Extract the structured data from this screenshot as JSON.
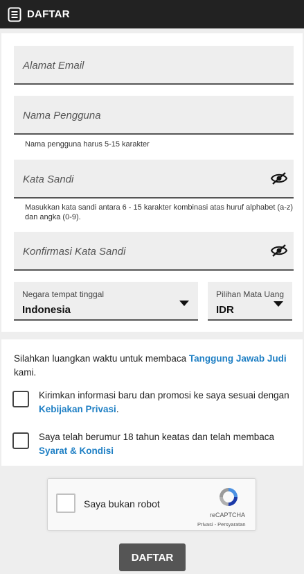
{
  "header": {
    "title": "DAFTAR",
    "icon": "document-list-icon"
  },
  "form": {
    "email": {
      "placeholder": "Alamat Email"
    },
    "username": {
      "placeholder": "Nama Pengguna",
      "hint": "Nama pengguna harus 5-15 karakter"
    },
    "password": {
      "placeholder": "Kata Sandi",
      "hint": "Masukkan kata sandi antara 6 - 15 karakter kombinasi atas huruf alphabet (a-z) dan angka (0-9)."
    },
    "confirm_password": {
      "placeholder": "Konfirmasi Kata Sandi"
    },
    "country": {
      "label": "Negara tempat tinggal",
      "value": "Indonesia"
    },
    "currency": {
      "label": "Pilihan Mata Uang",
      "value": "IDR"
    }
  },
  "terms": {
    "intro_prefix": "Silahkan luangkan waktu untuk membaca ",
    "intro_link": "Tanggung Jawab Judi",
    "intro_suffix": " kami.",
    "promo_text": "Kirimkan informasi baru dan promosi ke saya sesuai dengan ",
    "promo_link": "Kebijakan Privasi",
    "promo_suffix": ".",
    "age_text": "Saya telah berumur 18 tahun keatas dan telah membaca ",
    "age_link": "Syarat & Kondisi"
  },
  "recaptcha": {
    "label": "Saya bukan robot",
    "brand": "reCAPTCHA",
    "terms": "Privasi - Persyaratan"
  },
  "submit": {
    "label": "DAFTAR"
  },
  "colors": {
    "header_bg": "#222222",
    "link": "#1e7fc4",
    "button_bg": "#555555"
  }
}
